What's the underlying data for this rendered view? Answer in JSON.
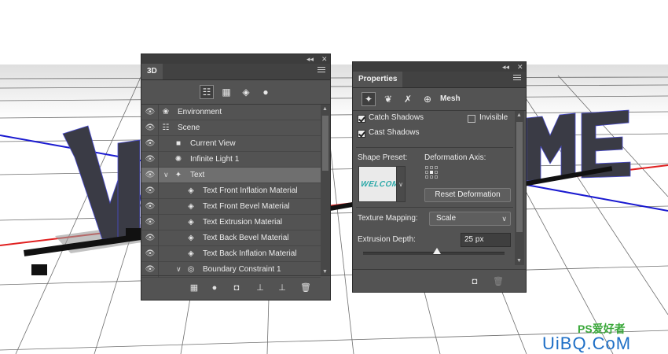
{
  "panel3d": {
    "title": "3D",
    "toolbar": [
      {
        "name": "filter-whole-scene-icon",
        "glyph": "☷",
        "selected": true
      },
      {
        "name": "filter-meshes-icon",
        "glyph": "▦",
        "selected": false
      },
      {
        "name": "filter-materials-icon",
        "glyph": "◈",
        "selected": false
      },
      {
        "name": "filter-lights-icon",
        "glyph": "●",
        "selected": false
      }
    ],
    "layers": [
      {
        "label": "Environment",
        "icon": "❀",
        "indent": 0,
        "arrow": "",
        "selected": false
      },
      {
        "label": "Scene",
        "icon": "☷",
        "indent": 0,
        "arrow": "",
        "selected": false
      },
      {
        "label": "Current View",
        "icon": "■",
        "indent": 1,
        "arrow": "",
        "selected": false
      },
      {
        "label": "Infinite Light 1",
        "icon": "✺",
        "indent": 1,
        "arrow": "",
        "selected": false
      },
      {
        "label": "Text",
        "icon": "✦",
        "indent": 1,
        "arrow": "∨",
        "selected": true
      },
      {
        "label": "Text Front Inflation Material",
        "icon": "◈",
        "indent": 2,
        "arrow": "",
        "selected": false
      },
      {
        "label": "Text Front Bevel Material",
        "icon": "◈",
        "indent": 2,
        "arrow": "",
        "selected": false
      },
      {
        "label": "Text Extrusion Material",
        "icon": "◈",
        "indent": 2,
        "arrow": "",
        "selected": false
      },
      {
        "label": "Text Back Bevel Material",
        "icon": "◈",
        "indent": 2,
        "arrow": "",
        "selected": false
      },
      {
        "label": "Text Back Inflation Material",
        "icon": "◈",
        "indent": 2,
        "arrow": "",
        "selected": false
      },
      {
        "label": "Boundary Constraint 1",
        "icon": "◎",
        "indent": 2,
        "arrow": "∨",
        "selected": false
      }
    ],
    "bottom_icons": [
      {
        "name": "add-mesh-icon",
        "glyph": "▦"
      },
      {
        "name": "add-light-icon",
        "glyph": "●"
      },
      {
        "name": "render-icon",
        "glyph": "◘"
      },
      {
        "name": "drop-to-ground-icon",
        "glyph": "⊥"
      },
      {
        "name": "constraint-icon",
        "glyph": "⊥"
      },
      {
        "name": "delete-icon",
        "glyph": "🗑"
      }
    ]
  },
  "properties": {
    "title": "Properties",
    "mesh_label": "Mesh",
    "catch_shadows": "Catch Shadows",
    "cast_shadows": "Cast Shadows",
    "invisible": "Invisible",
    "catch_shadows_checked": true,
    "cast_shadows_checked": true,
    "invisible_checked": false,
    "shape_preset_label": "Shape Preset:",
    "preset_thumb_text": "WELCOM",
    "deformation_axis_label": "Deformation Axis:",
    "reset_deformation": "Reset Deformation",
    "texture_mapping_label": "Texture Mapping:",
    "texture_mapping_value": "Scale",
    "extrusion_depth_label": "Extrusion Depth:",
    "extrusion_depth_value": "25 px",
    "extrusion_slider_fraction": 0.52
  },
  "watermark": {
    "line1": "PS爱好者",
    "line2": "UiBQ.CoM"
  },
  "colors": {
    "panel_bg": "#535353",
    "selected_row": "#6f6f6f",
    "text_3d": "#3a3b45",
    "axis_red": "#e02020",
    "axis_blue": "#1a1ad0"
  }
}
